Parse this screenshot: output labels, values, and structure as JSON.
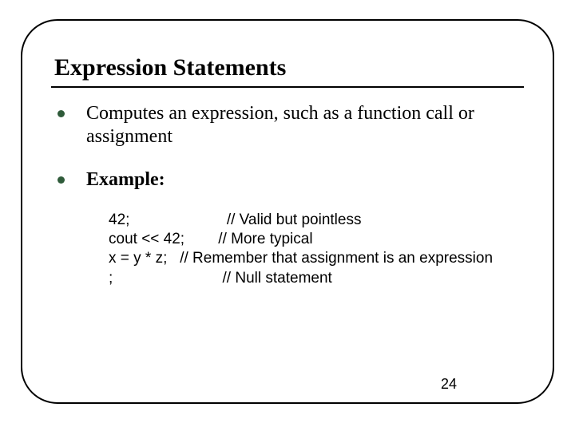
{
  "slide": {
    "title": "Expression Statements",
    "bullets": [
      {
        "text": "Computes an expression, such as a function call or assignment",
        "bold": false
      },
      {
        "text": "Example:",
        "bold": true
      }
    ],
    "example_lines": [
      "42;                       // Valid but pointless",
      "cout << 42;        // More typical",
      "x = y * z;   // Remember that assignment is an expression",
      ";                          // Null statement"
    ],
    "page_number": "24"
  }
}
